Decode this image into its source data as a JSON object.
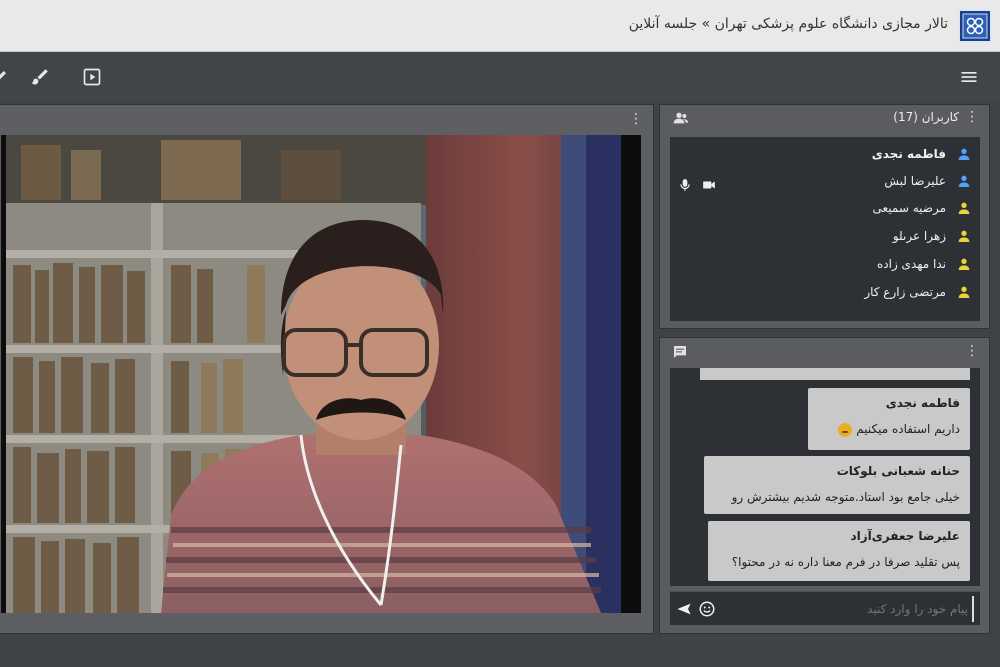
{
  "header": {
    "title": "تالار مجازی دانشگاه علوم پزشکی تهران » جلسه آنلاین",
    "logo_icon": "university-seal-icon"
  },
  "toolbar": {
    "icons": [
      "pen-icon",
      "brush-icon",
      "play-box-icon",
      "hamburger-menu-icon"
    ]
  },
  "video": {
    "menu_icon": "more-vert-icon"
  },
  "users": {
    "title": "کاربران (17)",
    "items": [
      {
        "name": "فاطمه نجدی",
        "role": "moderator",
        "color": "#4fa3ff",
        "bold": true
      },
      {
        "name": "علیرضا لبش",
        "role": "moderator",
        "color": "#4fa3ff",
        "bold": false
      },
      {
        "name": "مرضیه سمیعی",
        "role": "viewer",
        "color": "#e8d43a",
        "bold": false
      },
      {
        "name": "زهرا عرىلو",
        "role": "viewer",
        "color": "#e8d43a",
        "bold": false
      },
      {
        "name": "ندا مهدی زاده",
        "role": "viewer",
        "color": "#e8d43a",
        "bold": false
      },
      {
        "name": "مرتضی زارع کار",
        "role": "viewer",
        "color": "#e8d43a",
        "bold": false
      }
    ]
  },
  "chat": {
    "messages": [
      {
        "author": "فاطمه نجدی",
        "text": "داریم استفاده میکنیم",
        "emoji": "smile-emoji-icon"
      },
      {
        "author": "حنانه شعبانی بلوکات",
        "text": "خیلی جامع بود استاد.متوجه شدیم بیشترش رو"
      },
      {
        "author": "علیرضا جعفری‌آزاد",
        "text": "پس تقلید صرفا در فرم معنا داره نه در محتوا؟"
      }
    ],
    "input_placeholder": "پیام خود را وارد کنید"
  }
}
